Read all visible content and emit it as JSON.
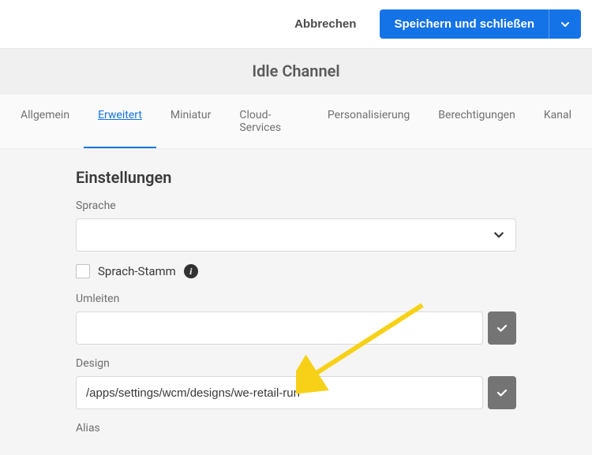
{
  "header": {
    "cancel_label": "Abbrechen",
    "save_label": "Speichern und schließen"
  },
  "title": "Idle Channel",
  "tabs": [
    {
      "label": "Allgemein",
      "active": false
    },
    {
      "label": "Erweitert",
      "active": true
    },
    {
      "label": "Miniatur",
      "active": false
    },
    {
      "label": "Cloud-Services",
      "active": false
    },
    {
      "label": "Personalisierung",
      "active": false
    },
    {
      "label": "Berechtigungen",
      "active": false
    },
    {
      "label": "Kanal",
      "active": false
    }
  ],
  "settings": {
    "heading": "Einstellungen",
    "language_label": "Sprache",
    "language_value": "",
    "language_root_label": "Sprach-Stamm",
    "redirect_label": "Umleiten",
    "redirect_value": "",
    "design_label": "Design",
    "design_value": "/apps/settings/wcm/designs/we-retail-run",
    "alias_label": "Alias"
  }
}
